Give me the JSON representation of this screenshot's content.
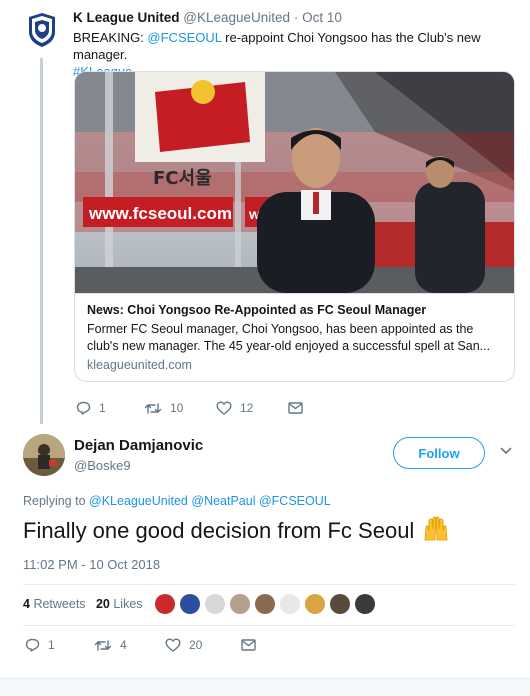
{
  "tweet1": {
    "name": "K League United",
    "handle": "@KLeagueUnited",
    "time": "· Oct 10",
    "text_prefix": "BREAKING: ",
    "mention": "@FCSEOUL",
    "text_rest": " re-appoint Choi Yongsoo has the Club's new manager.",
    "hashtag": "#KLeague",
    "card": {
      "image_sign_1": "www.fcseoul.com",
      "image_sign_2": "www.fcse",
      "image_sign_top": "FC서울",
      "title": "News: Choi Yongsoo Re-Appointed as FC Seoul Manager",
      "description": "Former FC Seoul manager, Choi Yongsoo, has been appointed as the club's new manager. The 45 year-old enjoyed a successful spell at San...",
      "domain": "kleagueunited.com"
    },
    "actions": {
      "reply_count": "1",
      "retweet_count": "10",
      "like_count": "12"
    }
  },
  "tweet2": {
    "name": "Dejan Damjanovic",
    "handle": "@Boske9",
    "follow_label": "Follow",
    "replying_label": "Replying to ",
    "replying_to": [
      "@KLeagueUnited",
      "@NeatPaul",
      "@FCSEOUL"
    ],
    "text": "Finally one good decision from Fc Seoul",
    "emoji": "raising-hands",
    "timestamp": "11:02 PM - 10 Oct 2018",
    "retweets_count": "4",
    "retweets_label": "Retweets",
    "likes_count": "20",
    "likes_label": "Likes",
    "likers": [
      "#cc2a2a",
      "#2b4f9e",
      "#d8d8d8",
      "#b5a089",
      "#8d6a4f",
      "#e8e8e8",
      "#d9a441",
      "#5a4a3a",
      "#3a3a3a"
    ],
    "actions": {
      "reply_count": "1",
      "retweet_count": "4",
      "like_count": "20"
    }
  },
  "colors": {
    "link": "#1b95e0",
    "accent": "#1da1f2",
    "muted": "#657786",
    "text": "#14171a"
  }
}
